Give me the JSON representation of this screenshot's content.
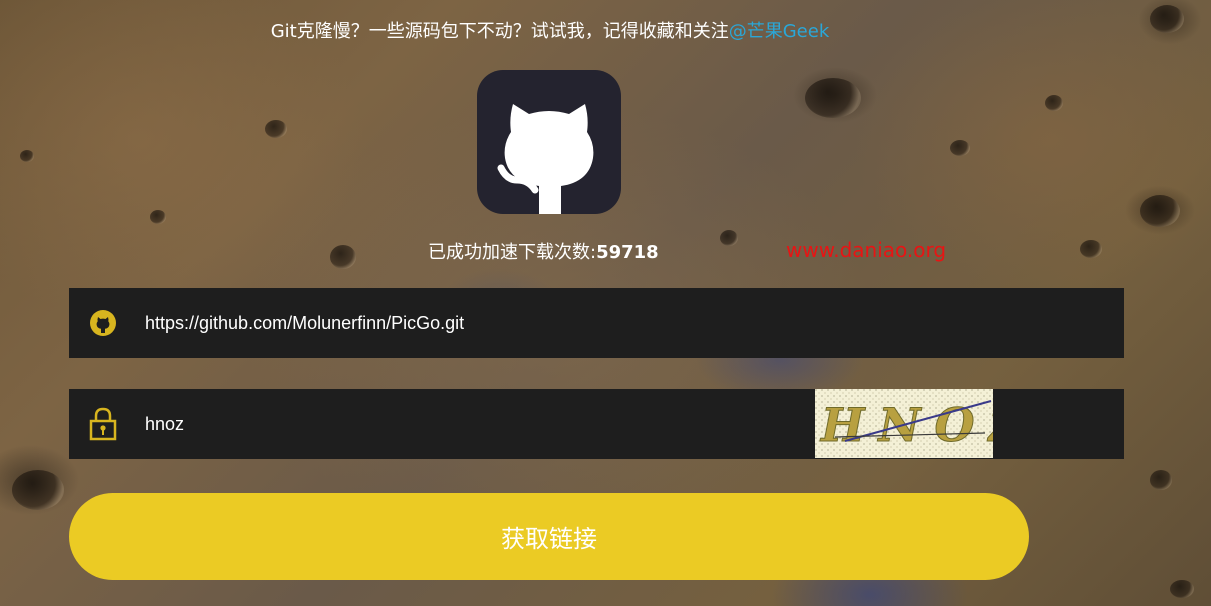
{
  "header": {
    "note_text": "Git克隆慢？一些源码包下不动？试试我，记得收藏和关注",
    "note_handle": "@芒果Geek"
  },
  "logo": {
    "icon": "github-octocat-icon"
  },
  "stats": {
    "label": "已成功加速下载次数:",
    "count": "59718"
  },
  "watermark": {
    "text": "www.daniao.org"
  },
  "url_field": {
    "icon": "github-icon",
    "value": "https://github.com/Molunerfinn/PicGo.git"
  },
  "captcha_field": {
    "icon": "lock-icon",
    "value": "hnoz",
    "captcha_text": "HNOZ"
  },
  "submit": {
    "label": "获取链接"
  },
  "colors": {
    "accent_yellow": "#ebcb24",
    "link_blue": "#2aa7d8",
    "watermark_red": "#e81414",
    "field_bg": "#1e1e1e",
    "logo_bg": "#24232f"
  }
}
